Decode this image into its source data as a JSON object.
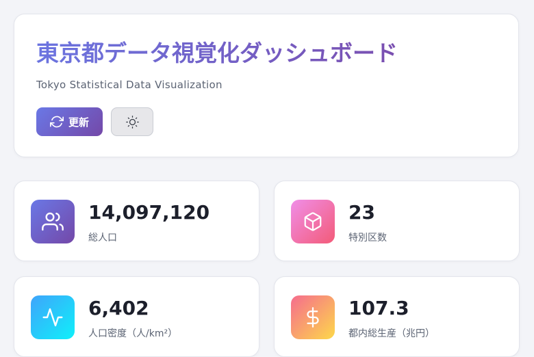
{
  "header": {
    "title": "東京都データ視覚化ダッシュボード",
    "subtitle": "Tokyo Statistical Data Visualization",
    "refresh_label": "更新",
    "refresh_icon": "refresh-icon",
    "theme_icon": "sun-icon"
  },
  "stats": [
    {
      "value": "14,097,120",
      "label": "総人口",
      "icon": "users-icon",
      "gradient": [
        "#6a78e6",
        "#7448a8"
      ]
    },
    {
      "value": "23",
      "label": "特別区数",
      "icon": "box-icon",
      "gradient": [
        "#f08ee8",
        "#f35b78"
      ]
    },
    {
      "value": "6,402",
      "label": "人口密度（人/km²）",
      "icon": "activity-icon",
      "gradient": [
        "#3fa4fb",
        "#0ff0fa"
      ]
    },
    {
      "value": "107.3",
      "label": "都内総生産（兆円）",
      "icon": "dollar-icon",
      "gradient": [
        "#f56c8e",
        "#fdd84a"
      ]
    }
  ]
}
